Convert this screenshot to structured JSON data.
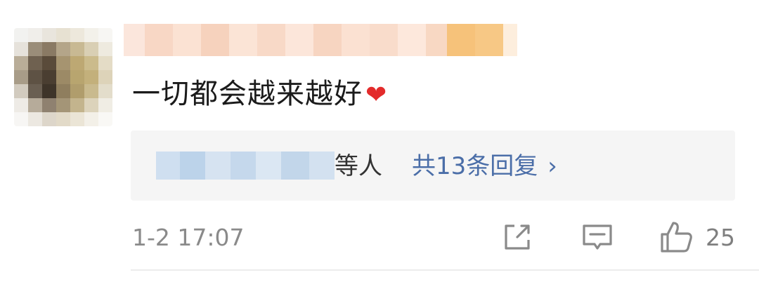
{
  "comment": {
    "text": "一切都会越来越好",
    "emoji": "❤"
  },
  "reply_preview": {
    "suffix": "等人",
    "link": "共13条回复",
    "chevron": "›"
  },
  "meta": {
    "time": "1-2 17:07",
    "like_count": "25"
  },
  "icons": {
    "share": "share-icon",
    "comment": "comment-icon",
    "like": "like-icon"
  },
  "colors": {
    "link": "#4b6ea8",
    "reply_box_bg": "#f5f5f5",
    "text": "#1b1b1b",
    "muted": "#8a8a8a"
  }
}
